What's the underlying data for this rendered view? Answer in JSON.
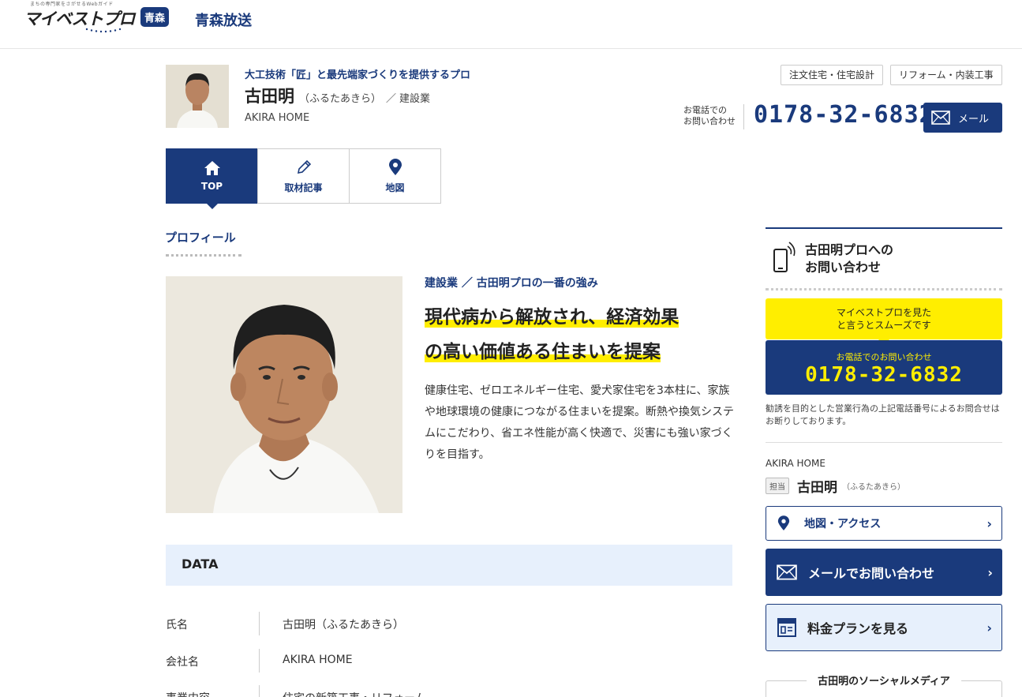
{
  "header": {
    "logo_tagline": "まちの専門家をさがせるWebガイド",
    "logo_text": "マイベストプロ",
    "logo_region": "青森",
    "broadcaster": "青森放送"
  },
  "pro": {
    "tagline": "大工技術「匠」と最先端家づくりを提供するプロ",
    "name": "古田明",
    "kana": "（ふるたあきら）",
    "separator": "／",
    "industry": "建設業",
    "company": "AKIRA HOME",
    "tags": [
      "注文住宅・住宅設計",
      "リフォーム・内装工事"
    ],
    "tel_label_line1": "お電話での",
    "tel_label_line2": "お問い合わせ",
    "tel": "0178-32-6832",
    "mail_label": "メール"
  },
  "tabs": [
    {
      "label": "TOP",
      "icon": "home-icon",
      "active": true
    },
    {
      "label": "取材記事",
      "icon": "pencil-icon",
      "active": false
    },
    {
      "label": "地図",
      "icon": "map-pin-icon",
      "active": false
    }
  ],
  "profile": {
    "heading": "プロフィール",
    "strength_label": "建設業 ／ 古田明プロの一番の強み",
    "catch_line1": "現代病から解放され、経済効果",
    "catch_line2": "の高い価値ある住まいを提案",
    "intro": "健康住宅、ゼロエネルギー住宅、愛犬家住宅を3本柱に、家族や地球環境の健康につながる住まいを提案。断熱や換気システムにこだわり、省エネ性能が高く快適で、災害にも強い家づくりを目指す。"
  },
  "data": {
    "title": "DATA",
    "rows": [
      {
        "key": "氏名",
        "value": "古田明（ふるたあきら）"
      },
      {
        "key": "会社名",
        "value": "AKIRA HOME"
      },
      {
        "key": "事業内容",
        "value": "住宅の新築工事・リフォーム"
      }
    ]
  },
  "sidebar": {
    "contact_title_line1": "古田明プロへの",
    "contact_title_line2": "お問い合わせ",
    "yellow_line1": "マイベストプロを見た",
    "yellow_line2": "と言うとスムーズです",
    "tel_label": "お電話でのお問い合わせ",
    "tel": "0178-32-6832",
    "notice": "勧誘を目的とした営業行為の上記電話番号によるお問合せはお断りしております。",
    "company": "AKIRA HOME",
    "badge": "担当",
    "name": "古田明",
    "kana": "（ふるたあきら）",
    "btn_map": "地図・アクセス",
    "btn_mail": "メールでお問い合わせ",
    "btn_plan": "料金プランを見る",
    "social_title": "古田明のソーシャルメディア",
    "arrow": "›"
  },
  "colors": {
    "navy": "#1a3a7c",
    "yellow": "#ffee00",
    "light_blue": "#e7f0fc"
  }
}
